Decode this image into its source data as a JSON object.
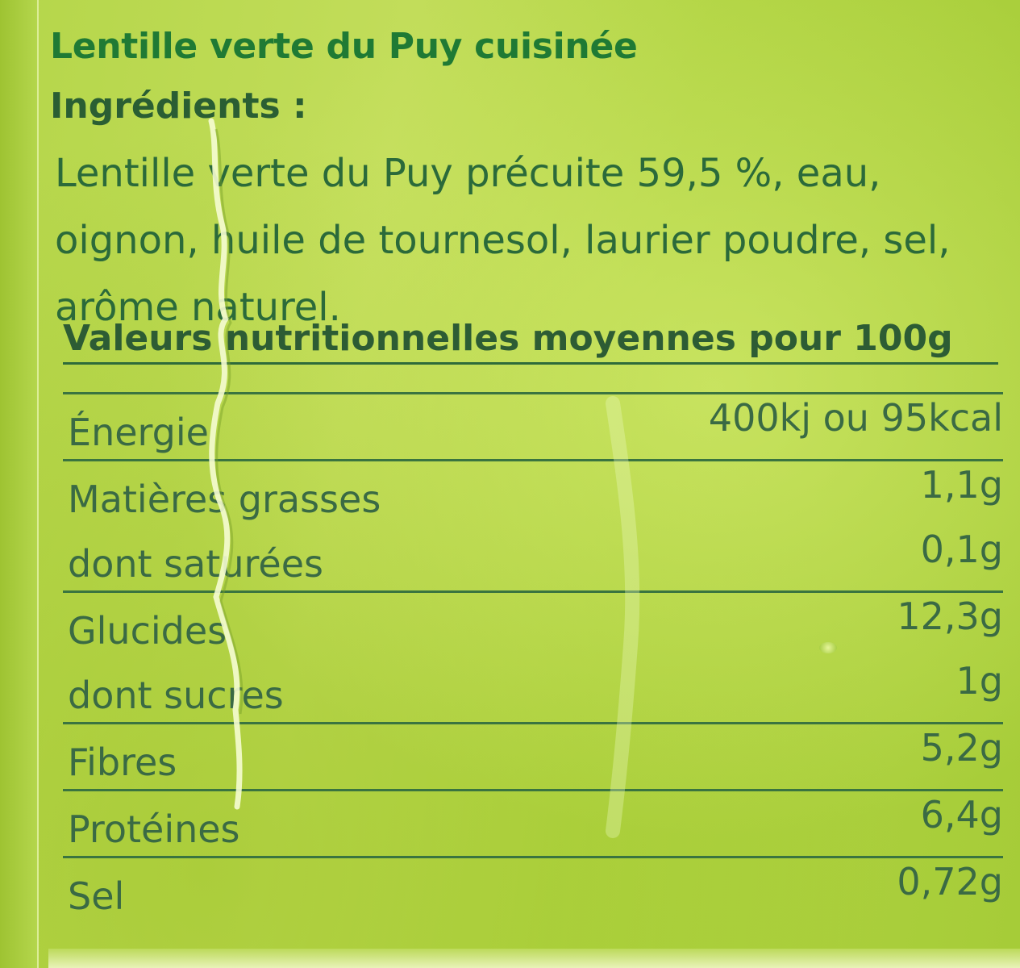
{
  "label": {
    "product_title": "Lentille verte du Puy cuisinée",
    "ingredients_heading": "Ingrédients :",
    "ingredients_text": "Lentille verte du Puy précuite 59,5 %, eau, oignon, huile de tournesol, laurier poudre, sel, arôme naturel.",
    "nutrition_heading": "Valeurs nutritionnelles moyennes pour 100g",
    "nutrition_rows": [
      {
        "name": "Énergie",
        "value": "400kj ou 95kcal"
      },
      {
        "name": "Matières grasses",
        "value": "1,1g"
      },
      {
        "name": "dont saturées",
        "value": "0,1g"
      },
      {
        "name": "Glucides",
        "value": "12,3g"
      },
      {
        "name": "dont sucres",
        "value": "1g"
      },
      {
        "name": "Fibres",
        "value": "5,2g"
      },
      {
        "name": "Protéines",
        "value": "6,4g"
      },
      {
        "name": "Sel",
        "value": "0,72g"
      }
    ]
  },
  "colors": {
    "background": "#b5d64a",
    "title_text": "#1f7a34",
    "body_text": "#2b6a3a",
    "rule_lines": "#3a7440"
  }
}
